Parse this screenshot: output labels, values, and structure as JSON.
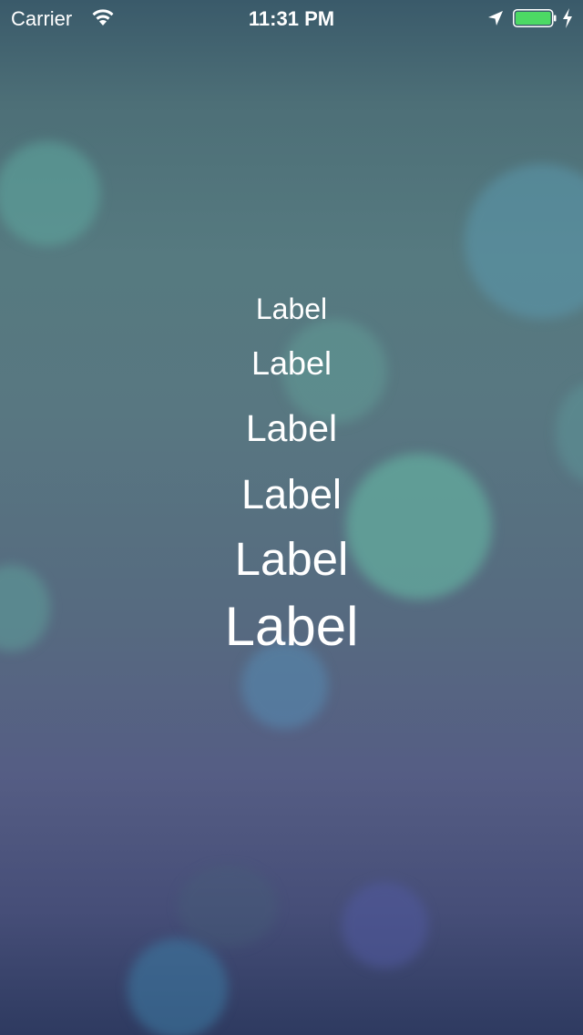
{
  "status_bar": {
    "carrier": "Carrier",
    "time": "11:31 PM",
    "battery_color": "#4cd964"
  },
  "labels": [
    {
      "text": "Label"
    },
    {
      "text": "Label"
    },
    {
      "text": "Label"
    },
    {
      "text": "Label"
    },
    {
      "text": "Label"
    },
    {
      "text": "Label"
    }
  ]
}
